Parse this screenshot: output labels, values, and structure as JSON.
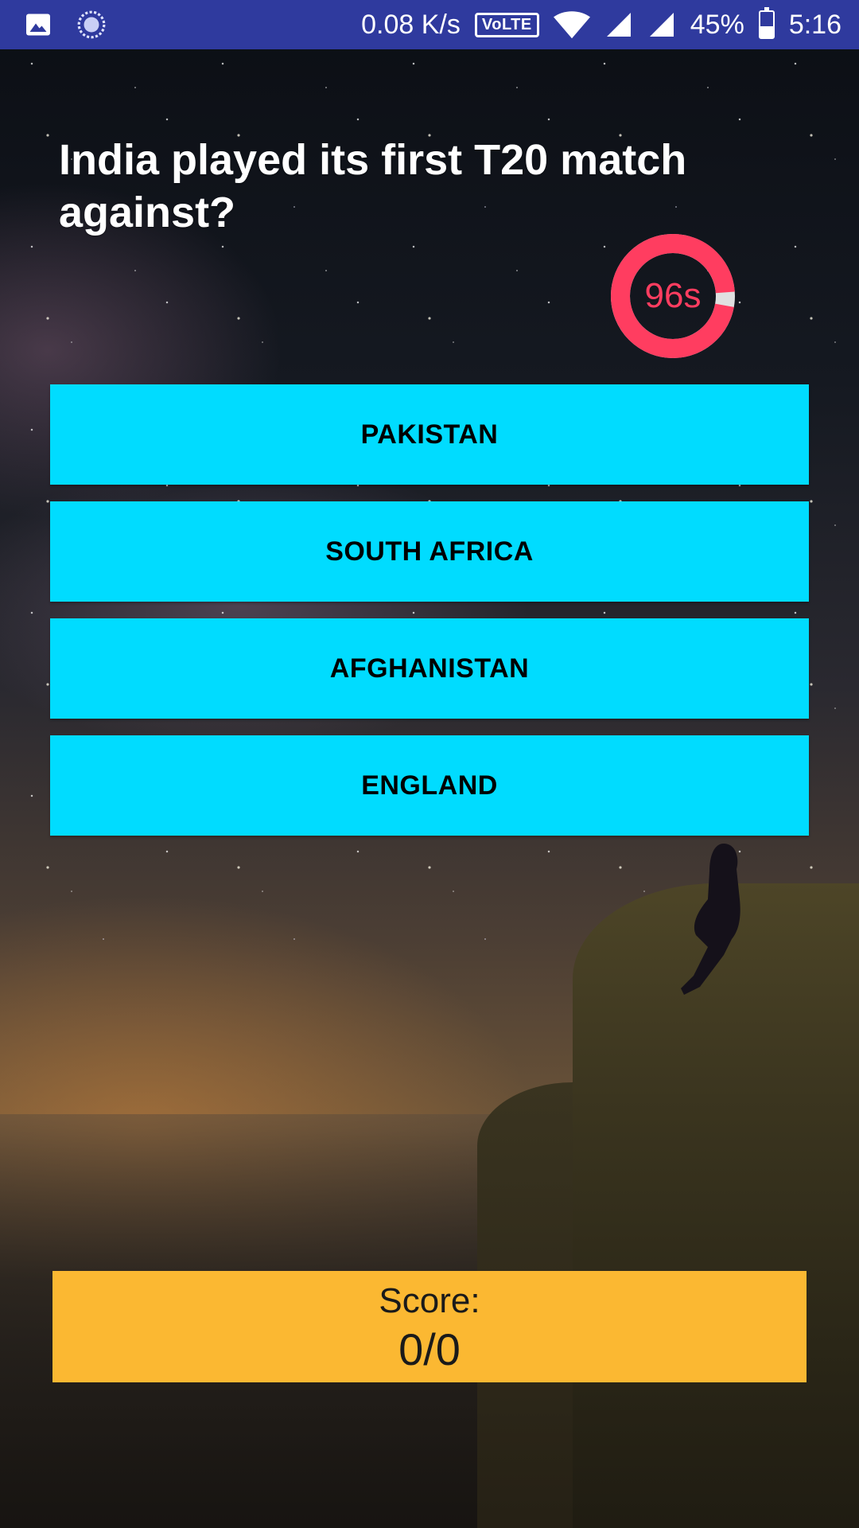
{
  "status_bar": {
    "speed": "0.08 K/s",
    "volte": "VoLTE",
    "battery": "45%",
    "battery_level": 0.45,
    "time": "5:16",
    "left_icons": [
      "image-icon",
      "sync-icon"
    ],
    "right_icons": [
      "wifi-icon",
      "signal-icon",
      "signal-icon",
      "battery-charging-icon"
    ]
  },
  "quiz": {
    "question": "India played its first T20 match against?",
    "timer_label": "96s",
    "timer_remaining_fraction": 0.96,
    "answers": [
      "PAKISTAN",
      "SOUTH AFRICA",
      "AFGHANISTAN",
      "ENGLAND"
    ]
  },
  "score": {
    "label": "Score:",
    "value": "0/0"
  },
  "colors": {
    "status_bar": "#2f3a9e",
    "answer_bg": "#00dcff",
    "score_bg": "#fbb832",
    "timer_ring": "#ff3d60",
    "timer_track": "#e0e0e0"
  }
}
